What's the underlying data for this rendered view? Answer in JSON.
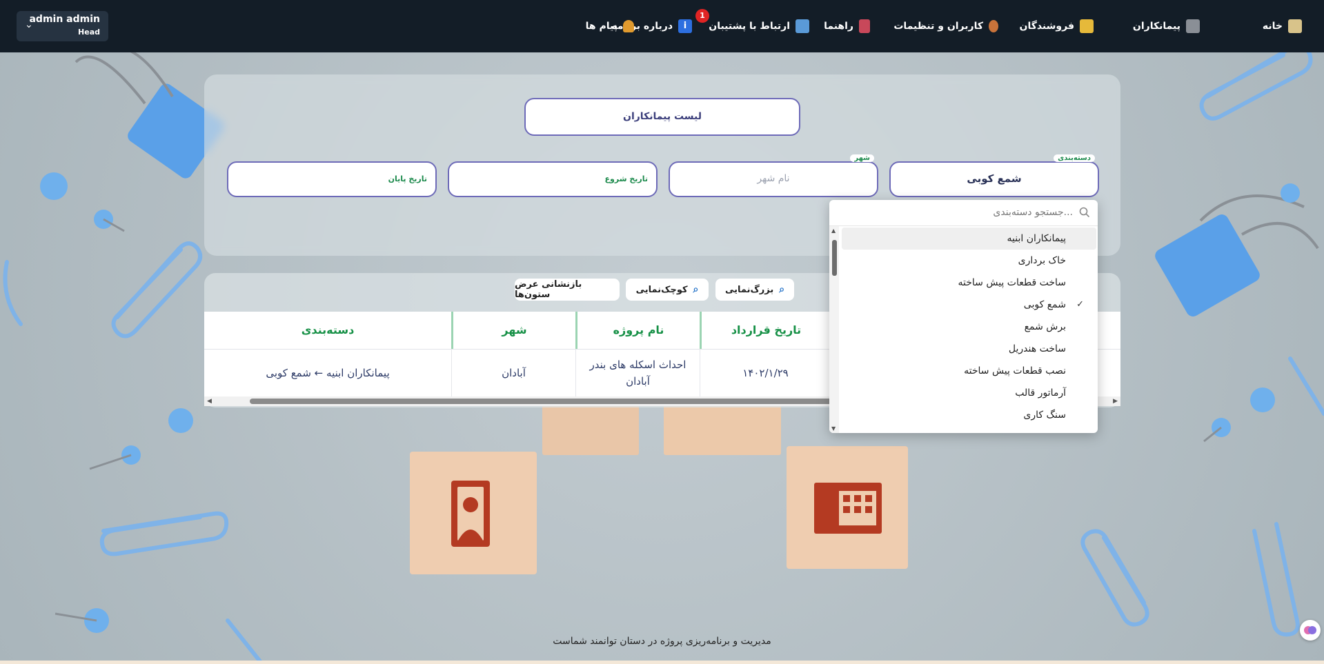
{
  "navbar": {
    "account": {
      "name": "admin admin",
      "role": "Head"
    },
    "items": [
      {
        "label": "خانه",
        "icon": "home-icon"
      },
      {
        "label": "پیمانکاران",
        "icon": "contractor-icon"
      },
      {
        "label": "فروشندگان",
        "icon": "store-icon"
      },
      {
        "label": "کاربران و تنظیمات",
        "icon": "user-settings-icon"
      },
      {
        "label": "راهنما",
        "icon": "guide-book-icon"
      },
      {
        "label": "ارتباط با پشتیبان",
        "icon": "chat-support-icon"
      },
      {
        "label": "درباره برنامه",
        "icon": "info-icon"
      },
      {
        "label": "پیام ها",
        "icon": "bell-icon"
      }
    ],
    "messages_badge": "1"
  },
  "filters": {
    "title": "لیست پیمانکاران",
    "category": {
      "label": "دسته‌بندی",
      "value": "شمع کوبی"
    },
    "city": {
      "label": "شهر",
      "placeholder": "نام شهر"
    },
    "start_date": {
      "label": "تاریخ شروع"
    },
    "end_date": {
      "label": "تاریخ پایان"
    }
  },
  "dropdown": {
    "search_placeholder": "جستجو دسته‌بندی...",
    "options": [
      {
        "label": "پیمانکاران ابنیه",
        "highlighted": true,
        "checked": false
      },
      {
        "label": "خاک برداری",
        "highlighted": false,
        "checked": false
      },
      {
        "label": "ساخت قطعات پیش ساخته",
        "highlighted": false,
        "checked": false
      },
      {
        "label": "شمع کوبی",
        "highlighted": false,
        "checked": true
      },
      {
        "label": "برش شمع",
        "highlighted": false,
        "checked": false
      },
      {
        "label": "ساخت هندریل",
        "highlighted": false,
        "checked": false
      },
      {
        "label": "نصب قطعات پیش ساخته",
        "highlighted": false,
        "checked": false
      },
      {
        "label": "آرماتور قالب",
        "highlighted": false,
        "checked": false
      },
      {
        "label": "سنگ کاری",
        "highlighted": false,
        "checked": false
      }
    ]
  },
  "toolbar": {
    "zoom_in": "بزرگ‌نمایی",
    "zoom_out": "کوچک‌نمایی",
    "reset_columns": "بازنشانی عرض ستون‌ها"
  },
  "table": {
    "headers": {
      "category": "دسته‌بندی",
      "city": "شهر",
      "project": "نام پروژه",
      "contract_date": "تاریخ قرارداد"
    },
    "rows": [
      {
        "category": "پیمانکاران ابنیه ← شمع کوبی",
        "city": "آبادان",
        "project_line1": "احداث اسکله های بندر",
        "project_line2": "آبادان",
        "contract_date": "۱۴۰۲/۱/۲۹"
      }
    ]
  },
  "footer": {
    "text": "مدیریت و برنامه‌ریزی پروژه در دستان توانمند شماست"
  },
  "colors": {
    "navbar": "#131d27",
    "accent_border": "#6d6ab8",
    "header_green": "#169046",
    "badge_red": "#e02424"
  }
}
